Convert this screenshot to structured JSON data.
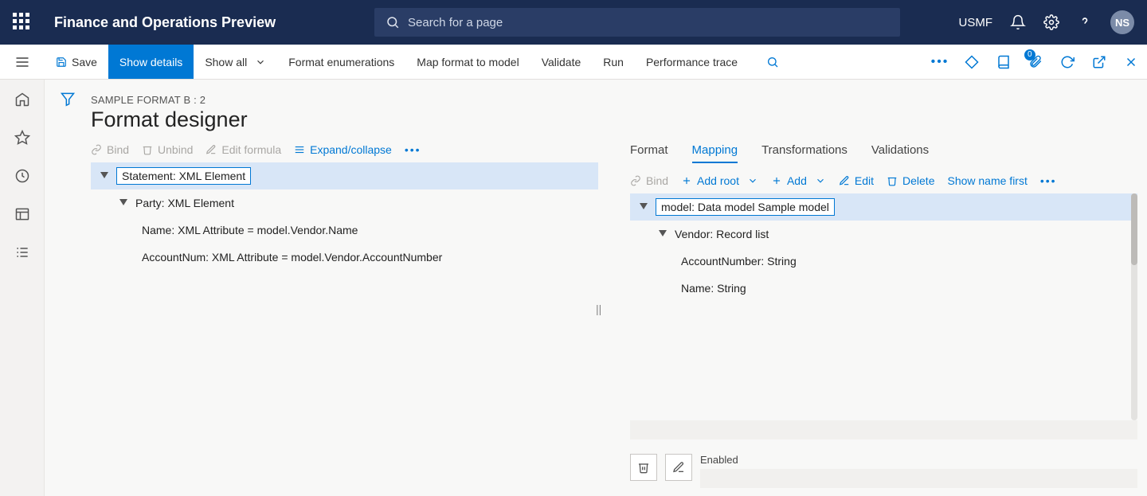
{
  "appbar": {
    "title": "Finance and Operations Preview",
    "search_placeholder": "Search for a page",
    "company": "USMF",
    "avatar_initials": "NS"
  },
  "commandbar": {
    "save": "Save",
    "show_details": "Show details",
    "show_all": "Show all",
    "format_enums": "Format enumerations",
    "map_format": "Map format to model",
    "validate": "Validate",
    "run": "Run",
    "perf_trace": "Performance trace",
    "attach_badge": "0"
  },
  "page": {
    "breadcrumb": "SAMPLE FORMAT B : 2",
    "title": "Format designer"
  },
  "left_toolbar": {
    "bind": "Bind",
    "unbind": "Unbind",
    "edit_formula": "Edit formula",
    "expand": "Expand/collapse"
  },
  "left_tree": {
    "n0": "Statement: XML Element",
    "n1": "Party: XML Element",
    "n2": "Name: XML Attribute = model.Vendor.Name",
    "n3": "AccountNum: XML Attribute = model.Vendor.AccountNumber"
  },
  "right_tabs": {
    "format": "Format",
    "mapping": "Mapping",
    "transformations": "Transformations",
    "validations": "Validations"
  },
  "right_toolbar": {
    "bind": "Bind",
    "add_root": "Add root",
    "add": "Add",
    "edit": "Edit",
    "delete": "Delete",
    "show_name_first": "Show name first"
  },
  "right_tree": {
    "n0": "model: Data model Sample model",
    "n1": "Vendor: Record list",
    "n2": "AccountNumber: String",
    "n3": "Name: String"
  },
  "bottom": {
    "enabled": "Enabled"
  }
}
